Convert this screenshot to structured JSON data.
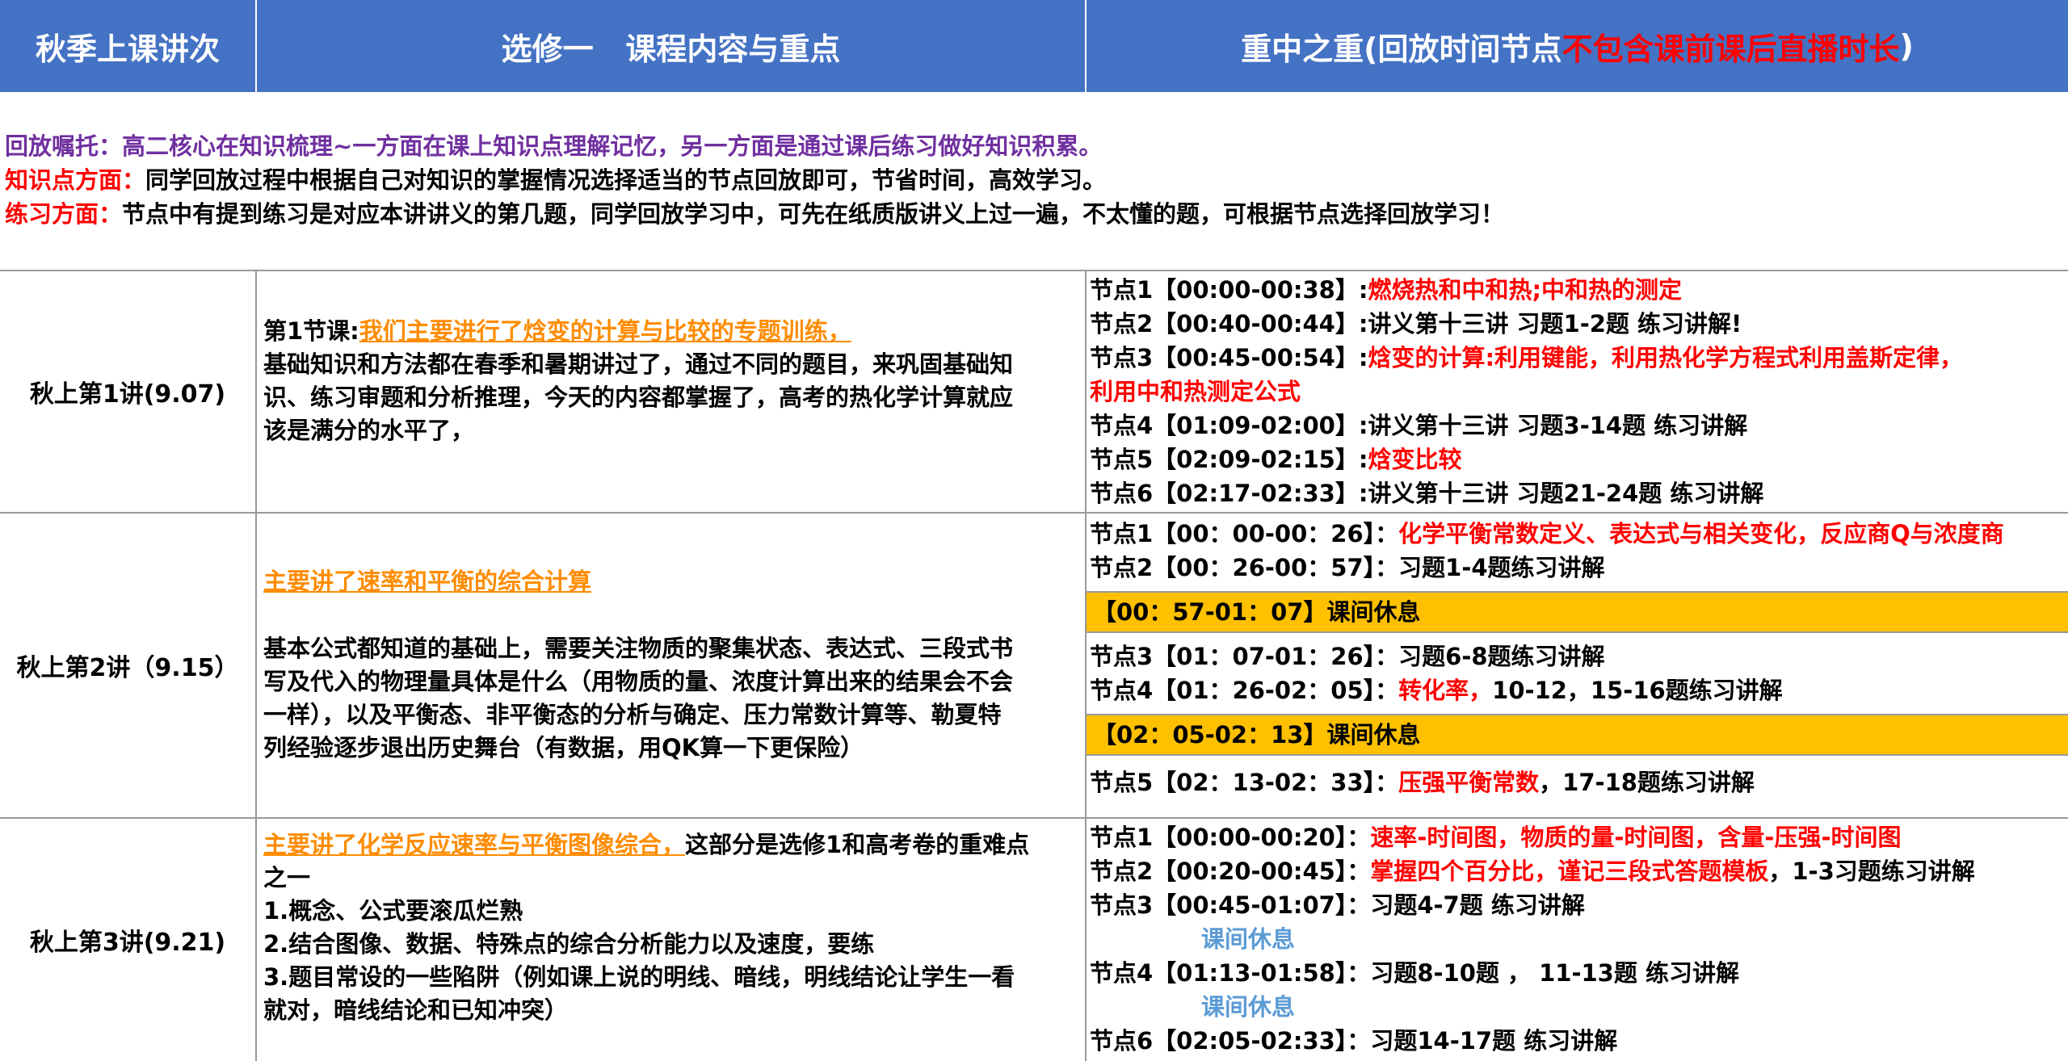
{
  "header": {
    "col1": "秋季上课讲次",
    "col2": "选修一   课程内容与重点",
    "col3_main": "重中之重(回放时间节点",
    "col3_red": "不包含课前课后直播时长",
    "col3_end": ")"
  },
  "notes": [
    {
      "label": "回放嘱托：",
      "text": "高二核心在知识梳理~一方面在课上知识点理解记忆，另一方面是通过课后练习做好知识积累。"
    },
    {
      "label": "知识点方面：",
      "text": "同学回放过程中根据自己对知识的掌握情况选择适当的节点回放即可，节省时间，高效学习。"
    },
    {
      "label": "练习方面：",
      "text": "节点中有提到练习是对应本讲讲义的第几题，同学回放学习中，可先在纸质版讲义上过一遍，不太懂的题，可根据节点选择回放学习！"
    }
  ],
  "lectures": [
    {
      "title": "秋上第1讲(9.07)",
      "content": {
        "prefix": "第1节课:",
        "highlight": "我们主要进行了焓变的计算与比较的专题训练，",
        "lines": [
          "基础知识和方法都在春季和暑期讲过了，通过不同的题目，来巩固基础知",
          "识、练习审题和分析推理，今天的内容都掌握了，高考的热化学计算就应",
          "该是满分的水平了，"
        ]
      },
      "nodes": [
        {
          "time": "节点1【00:00-00:38】:",
          "red": "燃烧热和中和热;中和热的测定",
          "rest": ""
        },
        {
          "time": "节点2【00:40-00:44】:",
          "red": "",
          "rest": "讲义第十三讲 习题1-2题 练习讲解!"
        },
        {
          "time": "节点3【00:45-00:54】:",
          "red": "焓变的计算:利用键能，利用热化学方程式利用盖斯定律，",
          "rest": ""
        },
        {
          "time": "",
          "red": "利用中和热测定公式",
          "rest": ""
        },
        {
          "time": "节点4【01:09-02:00】:",
          "red": "",
          "rest": "讲义第十三讲 习题3-14题 练习讲解"
        },
        {
          "time": "节点5【02:09-02:15】:",
          "red": "焓变比较",
          "rest": ""
        },
        {
          "time": "节点6【02:17-02:33】:",
          "red": "",
          "rest": "讲义第十三讲 习题21-24题 练习讲解"
        }
      ]
    },
    {
      "title": "秋上第2讲（9.15）",
      "content": {
        "highlight": "主要讲了速率和平衡的综合计算",
        "lines": [
          "基本公式都知道的基础上，需要关注物质的聚集状态、表达式、三段式书",
          "写及代入的物理量具体是什么（用物质的量、浓度计算出来的结果会不会",
          "一样），以及平衡态、非平衡态的分析与确定、压力常数计算等、勒夏特",
          "列经验逐步退出历史舞台（有数据，用QK算一下更保险）"
        ]
      },
      "nodes_a": [
        {
          "time": "节点1【00：00-00：26】：",
          "red": "化学平衡常数定义、表达式与相关变化，反应商Q与浓度商",
          "rest": ""
        },
        {
          "time": "节点2【00：26-00：57】：",
          "red": "",
          "rest": "习题1-4题练习讲解"
        }
      ],
      "break1": "【00：57-01：07】课间休息",
      "nodes_b": [
        {
          "time": "节点3【01：07-01：26】：",
          "red": "",
          "rest": "习题6-8题练习讲解"
        },
        {
          "time": "节点4【01：26-02：05】：",
          "red": "转化率，",
          "rest": "10-12，15-16题练习讲解"
        }
      ],
      "break2": "【02：05-02：13】课间休息",
      "nodes_c": [
        {
          "time": "节点5【02：13-02：33】：",
          "red": "压强平衡常数",
          "rest": "，17-18题练习讲解"
        }
      ]
    },
    {
      "title": "秋上第3讲(9.21)",
      "content": {
        "highlight": "主要讲了化学反应速率与平衡图像综合，",
        "highlight_rest": "这部分是选修1和高考卷的重难点",
        "lines": [
          "之一",
          "1.概念、公式要滚瓜烂熟",
          "2.结合图像、数据、特殊点的综合分析能力以及速度，要练",
          "3.题目常设的一些陷阱（例如课上说的明线、暗线，明线结论让学生一看",
          "就对，暗线结论和已知冲突）"
        ]
      },
      "nodes": [
        {
          "time": "节点1【00:00-00:20】：",
          "red": "速率-时间图，物质的量-时间图，含量-压强-时间图",
          "rest": "",
          "type": "node"
        },
        {
          "time": "节点2【00:20-00:45】：",
          "red": "掌握四个百分比，谨记三段式答题模板",
          "rest": "，1-3习题练习讲解",
          "type": "node"
        },
        {
          "time": "节点3【00:45-01:07】：",
          "red": "",
          "rest": "习题4-7题 练习讲解",
          "type": "node"
        },
        {
          "time": "",
          "red": "",
          "rest": "课间休息",
          "type": "break"
        },
        {
          "time": "节点4【01:13-01:58】：",
          "red": "",
          "rest": "习题8-10题 ， 11-13题 练习讲解",
          "type": "node"
        },
        {
          "time": "",
          "red": "",
          "rest": "课间休息",
          "type": "break"
        },
        {
          "time": "节点6【02:05-02:33】：",
          "red": "",
          "rest": "习题14-17题 练习讲解",
          "type": "node"
        }
      ]
    }
  ]
}
